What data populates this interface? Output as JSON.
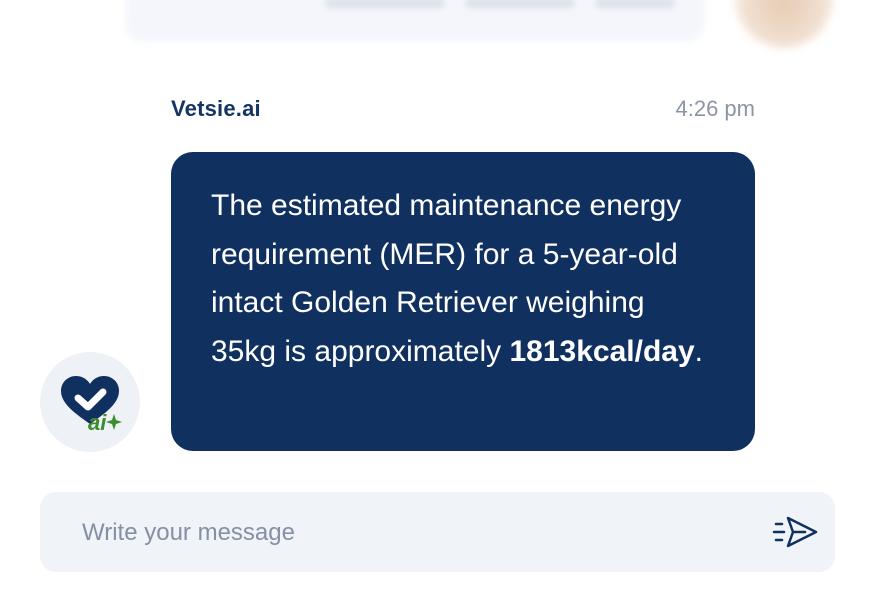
{
  "chat": {
    "message": {
      "sender": "Vetsie.ai",
      "time": "4:26 pm",
      "text_lead": "The estimated maintenance energy requirement (MER) for a 5-year-old intact Golden Retriever weighing 35kg is approximately ",
      "text_bold": "1813kcal/day",
      "text_tail": "."
    },
    "avatar": {
      "icon": "heart-ai-logo",
      "badge_text": "ai"
    }
  },
  "composer": {
    "placeholder": "Write your message",
    "send_icon": "paper-plane-send-icon"
  },
  "colors": {
    "bubble": "#10305f",
    "sender": "#143466",
    "time": "#8c94a6",
    "logo_green": "#3b8d2f",
    "composer_bg": "#f0f3f7"
  }
}
